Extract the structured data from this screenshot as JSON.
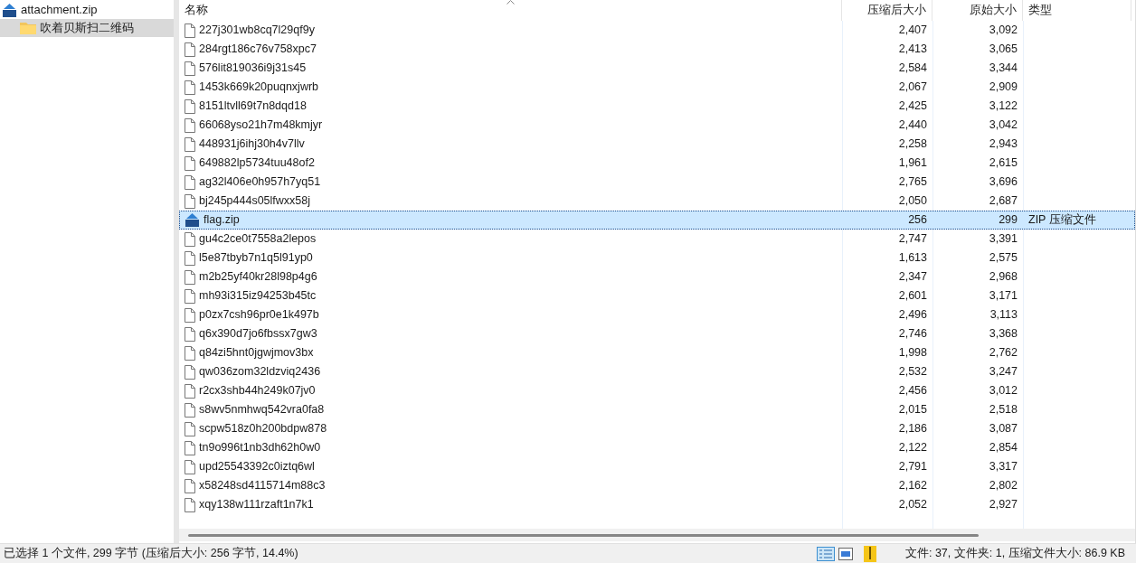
{
  "tree": [
    {
      "label": "attachment.zip",
      "kind": "zip",
      "selected": false,
      "children": [
        {
          "label": "吹着贝斯扫二维码",
          "kind": "folder",
          "selected": true
        }
      ]
    }
  ],
  "columns": [
    "名称",
    "压缩后大小",
    "原始大小",
    "类型"
  ],
  "rows": [
    {
      "name": "227j301wb8cq7l29qf9y",
      "kind": "file",
      "packed": "2,407",
      "size": "3,092",
      "selected": false
    },
    {
      "name": "284rgt186c76v758xpc7",
      "kind": "file",
      "packed": "2,413",
      "size": "3,065",
      "selected": false
    },
    {
      "name": "576lit819036i9j31s45",
      "kind": "file",
      "packed": "2,584",
      "size": "3,344",
      "selected": false
    },
    {
      "name": "1453k669k20puqnxjwrb",
      "kind": "file",
      "packed": "2,067",
      "size": "2,909",
      "selected": false
    },
    {
      "name": "8151ltvll69t7n8dqd18",
      "kind": "file",
      "packed": "2,425",
      "size": "3,122",
      "selected": false
    },
    {
      "name": "66068yso21h7m48kmjyr",
      "kind": "file",
      "packed": "2,440",
      "size": "3,042",
      "selected": false
    },
    {
      "name": "448931j6ihj30h4v7llv",
      "kind": "file",
      "packed": "2,258",
      "size": "2,943",
      "selected": false
    },
    {
      "name": "649882lp5734tuu48of2",
      "kind": "file",
      "packed": "1,961",
      "size": "2,615",
      "selected": false
    },
    {
      "name": "ag32l406e0h957h7yq51",
      "kind": "file",
      "packed": "2,765",
      "size": "3,696",
      "selected": false
    },
    {
      "name": "bj245p444s05lfwxx58j",
      "kind": "file",
      "packed": "2,050",
      "size": "2,687",
      "selected": false
    },
    {
      "name": "flag.zip",
      "kind": "zip",
      "packed": "256",
      "size": "299",
      "type": "ZIP 压缩文件",
      "selected": true
    },
    {
      "name": "gu4c2ce0t7558a2lepos",
      "kind": "file",
      "packed": "2,747",
      "size": "3,391",
      "selected": false
    },
    {
      "name": "l5e87tbyb7n1q5l91yp0",
      "kind": "file",
      "packed": "1,613",
      "size": "2,575",
      "selected": false
    },
    {
      "name": "m2b25yf40kr28l98p4g6",
      "kind": "file",
      "packed": "2,347",
      "size": "2,968",
      "selected": false
    },
    {
      "name": "mh93i315iz94253b45tc",
      "kind": "file",
      "packed": "2,601",
      "size": "3,171",
      "selected": false
    },
    {
      "name": "p0zx7csh96pr0e1k497b",
      "kind": "file",
      "packed": "2,496",
      "size": "3,113",
      "selected": false
    },
    {
      "name": "q6x390d7jo6fbssx7gw3",
      "kind": "file",
      "packed": "2,746",
      "size": "3,368",
      "selected": false
    },
    {
      "name": "q84zi5hnt0jgwjmov3bx",
      "kind": "file",
      "packed": "1,998",
      "size": "2,762",
      "selected": false
    },
    {
      "name": "qw036zom32ldzviq2436",
      "kind": "file",
      "packed": "2,532",
      "size": "3,247",
      "selected": false
    },
    {
      "name": "r2cx3shb44h249k07jv0",
      "kind": "file",
      "packed": "2,456",
      "size": "3,012",
      "selected": false
    },
    {
      "name": "s8wv5nmhwq542vra0fa8",
      "kind": "file",
      "packed": "2,015",
      "size": "2,518",
      "selected": false
    },
    {
      "name": "scpw518z0h200bdpw878",
      "kind": "file",
      "packed": "2,186",
      "size": "3,087",
      "selected": false
    },
    {
      "name": "tn9o996t1nb3dh62h0w0",
      "kind": "file",
      "packed": "2,122",
      "size": "2,854",
      "selected": false
    },
    {
      "name": "upd25543392c0iztq6wl",
      "kind": "file",
      "packed": "2,791",
      "size": "3,317",
      "selected": false
    },
    {
      "name": "x58248sd4115714m88c3",
      "kind": "file",
      "packed": "2,162",
      "size": "2,802",
      "selected": false
    },
    {
      "name": "xqy138w111rzaft1n7k1",
      "kind": "file",
      "packed": "2,052",
      "size": "2,927",
      "selected": false
    }
  ],
  "status_bar": {
    "left": "已选择 1 个文件, 299 字节 (压缩后大小: 256 字节, 14.4%)",
    "right": "文件: 37, 文件夹: 1, 压缩文件大小: 86.9 KB"
  }
}
